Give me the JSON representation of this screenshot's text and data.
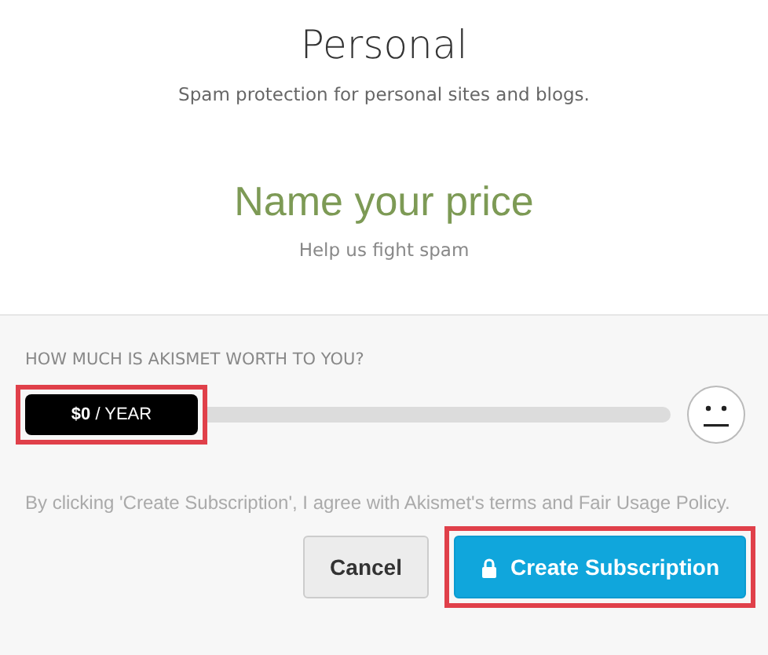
{
  "plan": {
    "title": "Personal",
    "description": "Spam protection for personal sites and blogs."
  },
  "pricing": {
    "heading": "Name your price",
    "subheading": "Help us fight spam"
  },
  "slider": {
    "label": "HOW MUCH IS AKISMET WORTH TO YOU?",
    "value": "**$0** / YEAR",
    "highlighted": true
  },
  "terms": "By clicking 'Create Subscription', I agree with Akismet's terms and Fair Usage Policy.",
  "buttons": [
    {
      "kind": "secondary",
      "label": "Cancel"
    },
    {
      "kind": "primary",
      "label": "Create Subscription",
      "highlighted": true
    }
  ]
}
